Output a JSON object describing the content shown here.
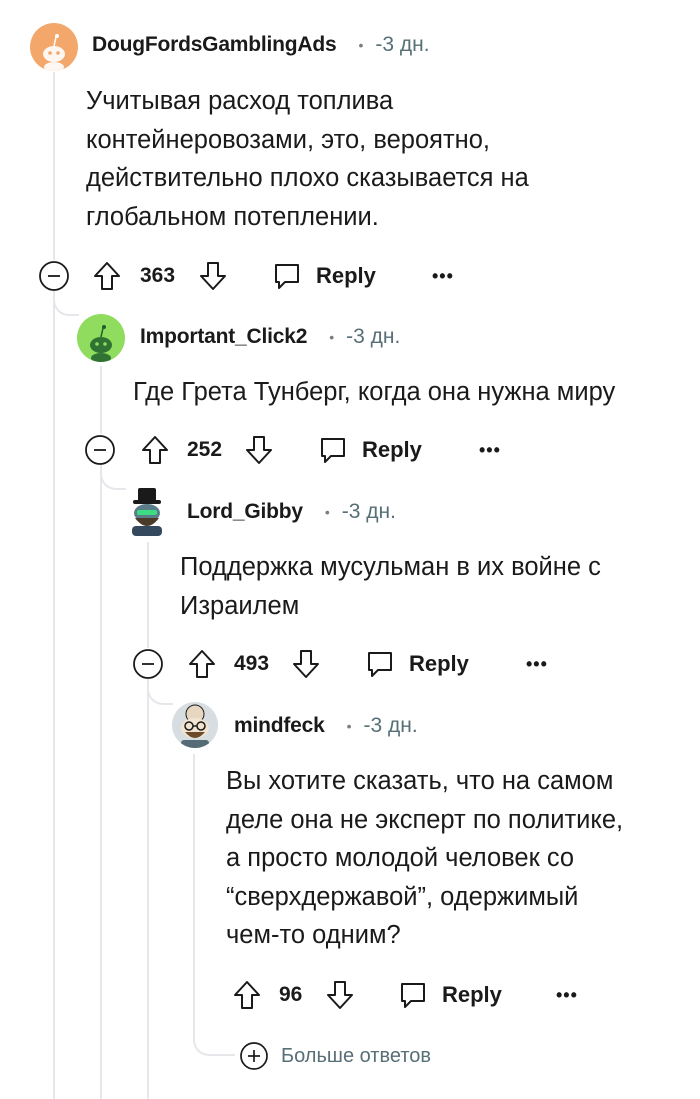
{
  "comments": [
    {
      "username": "DougFordsGamblingAds",
      "time": "-3 дн.",
      "body_lines": [
        "Учитывая расход топлива",
        "контейнеровозами, это, вероятно,",
        "действительно плохо сказывается на",
        "глобальном потеплении."
      ],
      "votes": "363",
      "reply_label": "Reply",
      "more_label": "•••",
      "avatar_icon": "snoo-default-avatar",
      "avatar_color": "#f3a76a"
    },
    {
      "username": "Important_Click2",
      "time": "-3 дн.",
      "body_lines": [
        "Где Грета Тунберг, когда она нужна миру"
      ],
      "votes": "252",
      "reply_label": "Reply",
      "more_label": "•••",
      "avatar_icon": "snoo-default-avatar",
      "avatar_color": "#8fdc5e"
    },
    {
      "username": "Lord_Gibby",
      "time": "-3 дн.",
      "body_lines": [
        "Поддержка мусульман в их войне с",
        "Израилем"
      ],
      "votes": "493",
      "reply_label": "Reply",
      "more_label": "•••",
      "avatar_icon": "top-hat-snoo-avatar"
    },
    {
      "username": "mindfeck",
      "time": "-3 дн.",
      "body_lines": [
        "Вы хотите сказать, что на самом",
        "деле она не эксперт по политике,",
        "а просто молодой человек со",
        "“сверхдержавой”, одержимый",
        "чем-то одним?"
      ],
      "votes": "96",
      "reply_label": "Reply",
      "more_label": "•••",
      "avatar_icon": "glasses-snoo-avatar"
    }
  ],
  "more_replies_label": "Больше ответов",
  "colors": {
    "thread_line": "#e5e7ea",
    "meta_gray": "#576f76",
    "text": "#1a1a1b"
  }
}
